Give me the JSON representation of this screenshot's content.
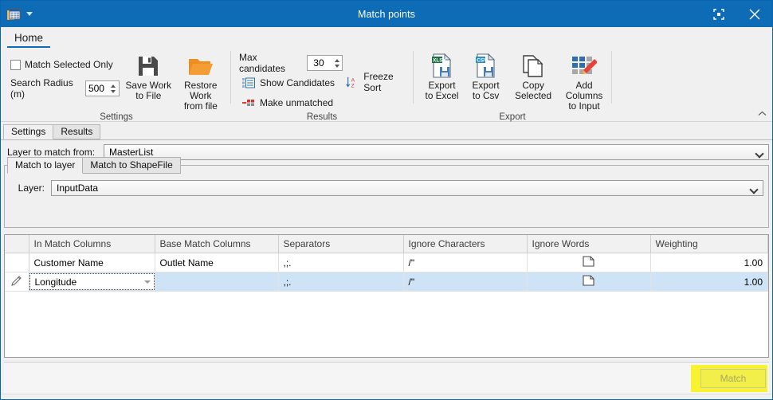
{
  "window": {
    "title": "Match points",
    "app_icon": "table-report-icon",
    "quick_access_caret": "chevron-down-icon",
    "restore_button": "restore-window-icon",
    "close_button": "close-icon"
  },
  "ribbon": {
    "tabs": [
      {
        "label": "Home",
        "active": true
      }
    ],
    "collapse_icon": "chevron-up-icon",
    "groups": [
      {
        "name": "Settings",
        "label": "Settings",
        "checkbox": {
          "label": "Match Selected Only",
          "checked": false
        },
        "search_radius": {
          "label": "Search Radius (m)",
          "value": "500"
        },
        "buttons": [
          {
            "label": "Save Work\nto File",
            "icon": "floppy-disk-icon"
          },
          {
            "label": "Restore Work\nfrom file",
            "icon": "open-folder-icon"
          }
        ]
      },
      {
        "name": "Results",
        "label": "Results",
        "max_candidates": {
          "label": "Max candidates",
          "value": "30"
        },
        "show_candidates": {
          "label": "Show Candidates",
          "icon": "grid-list-icon"
        },
        "make_unmatched": {
          "label": "Make unmatched",
          "icon": "remove-row-icon"
        },
        "freeze_sort": {
          "label": "Freeze Sort",
          "icon": "sort-az-icon"
        }
      },
      {
        "name": "Export",
        "label": "Export",
        "buttons": [
          {
            "label": "Export\nto Excel",
            "icon": "xlsx-file-icon"
          },
          {
            "label": "Export\nto Csv",
            "icon": "csv-file-icon"
          },
          {
            "label": "Copy Selected",
            "icon": "copy-pages-icon"
          },
          {
            "label": "Add Columns\nto Input",
            "icon": "add-columns-pencil-icon"
          }
        ]
      }
    ]
  },
  "main": {
    "tabs": [
      {
        "label": "Settings",
        "active": true
      },
      {
        "label": "Results",
        "active": false
      }
    ],
    "layer_to_match_from": {
      "label": "Layer to match from:",
      "value": "MasterList",
      "dropdown_icon": "chevron-down-icon"
    },
    "match_tabs": [
      {
        "label": "Match to layer",
        "active": true
      },
      {
        "label": "Match to ShapeFile",
        "active": false
      }
    ],
    "layer": {
      "label": "Layer:",
      "value": "InputData",
      "dropdown_icon": "chevron-down-icon"
    }
  },
  "grid": {
    "columns": [
      "In Match Columns",
      "Base Match Columns",
      "Separators",
      "Ignore Characters",
      "Ignore Words",
      "Weighting"
    ],
    "rows": [
      {
        "indicator": "",
        "in_match_column": "Customer Name",
        "base_match_column": "Outlet Name",
        "separators": ",;.",
        "ignore_characters": "/\"",
        "ignore_words_icon": "document-icon",
        "weighting": "1.00",
        "selected": false,
        "editing": false
      },
      {
        "indicator": "pencil-edit-icon",
        "in_match_column": "Longitude",
        "base_match_column": "",
        "separators": ",;.",
        "ignore_characters": "/\"",
        "ignore_words_icon": "document-icon",
        "weighting": "1.00",
        "selected": true,
        "editing": true,
        "editor_dropdown_icon": "triangle-down-icon"
      }
    ]
  },
  "footer": {
    "match_button": {
      "label": "Match",
      "disabled": true,
      "highlighted": true
    }
  },
  "colors": {
    "title_bar": "#0d6cb5",
    "ribbon_bg": "#f0f0f0",
    "selection_row": "#cfe3f7",
    "highlight": "#f9f211",
    "accent_orange": "#ef8c22"
  }
}
